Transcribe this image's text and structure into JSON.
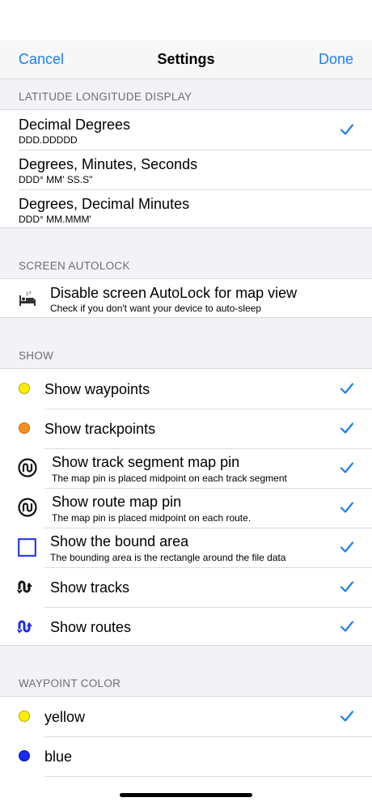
{
  "nav": {
    "cancel": "Cancel",
    "title": "Settings",
    "done": "Done"
  },
  "colors": {
    "accent": "#1a7ff5",
    "yellow": "#ffee00",
    "orange": "#f5901e",
    "blue": "#1a2cf0"
  },
  "sections": {
    "latlon": {
      "header": "LATITUDE LONGITUDE DISPLAY",
      "rows": [
        {
          "title": "Decimal Degrees",
          "sub": "DDD.DDDDD",
          "checked": true
        },
        {
          "title": "Degrees, Minutes, Seconds",
          "sub": "DDD° MM' SS.S\"",
          "checked": false
        },
        {
          "title": "Degrees, Decimal Minutes",
          "sub": "DDD° MM.MMM'",
          "checked": false
        }
      ]
    },
    "autolock": {
      "header": "SCREEN AUTOLOCK",
      "row": {
        "icon": "bed-icon",
        "title": "Disable screen AutoLock for map view",
        "sub": "Check if you don't want your device to auto-sleep",
        "checked": false
      }
    },
    "show": {
      "header": "SHOW",
      "rows": [
        {
          "icon": "yellow-dot-icon",
          "title": "Show waypoints",
          "checked": true
        },
        {
          "icon": "orange-dot-icon",
          "title": "Show trackpoints",
          "checked": true
        },
        {
          "icon": "track-pin-icon",
          "title": "Show track segment map pin",
          "sub": "The map pin is placed midpoint on each track segment",
          "checked": true
        },
        {
          "icon": "route-pin-icon",
          "title": "Show route map pin",
          "sub": "The map pin is placed midpoint on each route.",
          "checked": true
        },
        {
          "icon": "bound-square-icon",
          "title": "Show the bound area",
          "sub": "The bounding area is the rectangle around the file data",
          "checked": true
        },
        {
          "icon": "tracks-icon",
          "title": "Show tracks",
          "checked": true
        },
        {
          "icon": "routes-icon",
          "title": "Show routes",
          "checked": true
        }
      ]
    },
    "waypoint_color": {
      "header": "WAYPOINT COLOR",
      "rows": [
        {
          "icon": "yellow-dot-icon",
          "title": "yellow",
          "checked": true
        },
        {
          "icon": "blue-dot-icon",
          "title": "blue",
          "checked": false
        }
      ]
    }
  }
}
